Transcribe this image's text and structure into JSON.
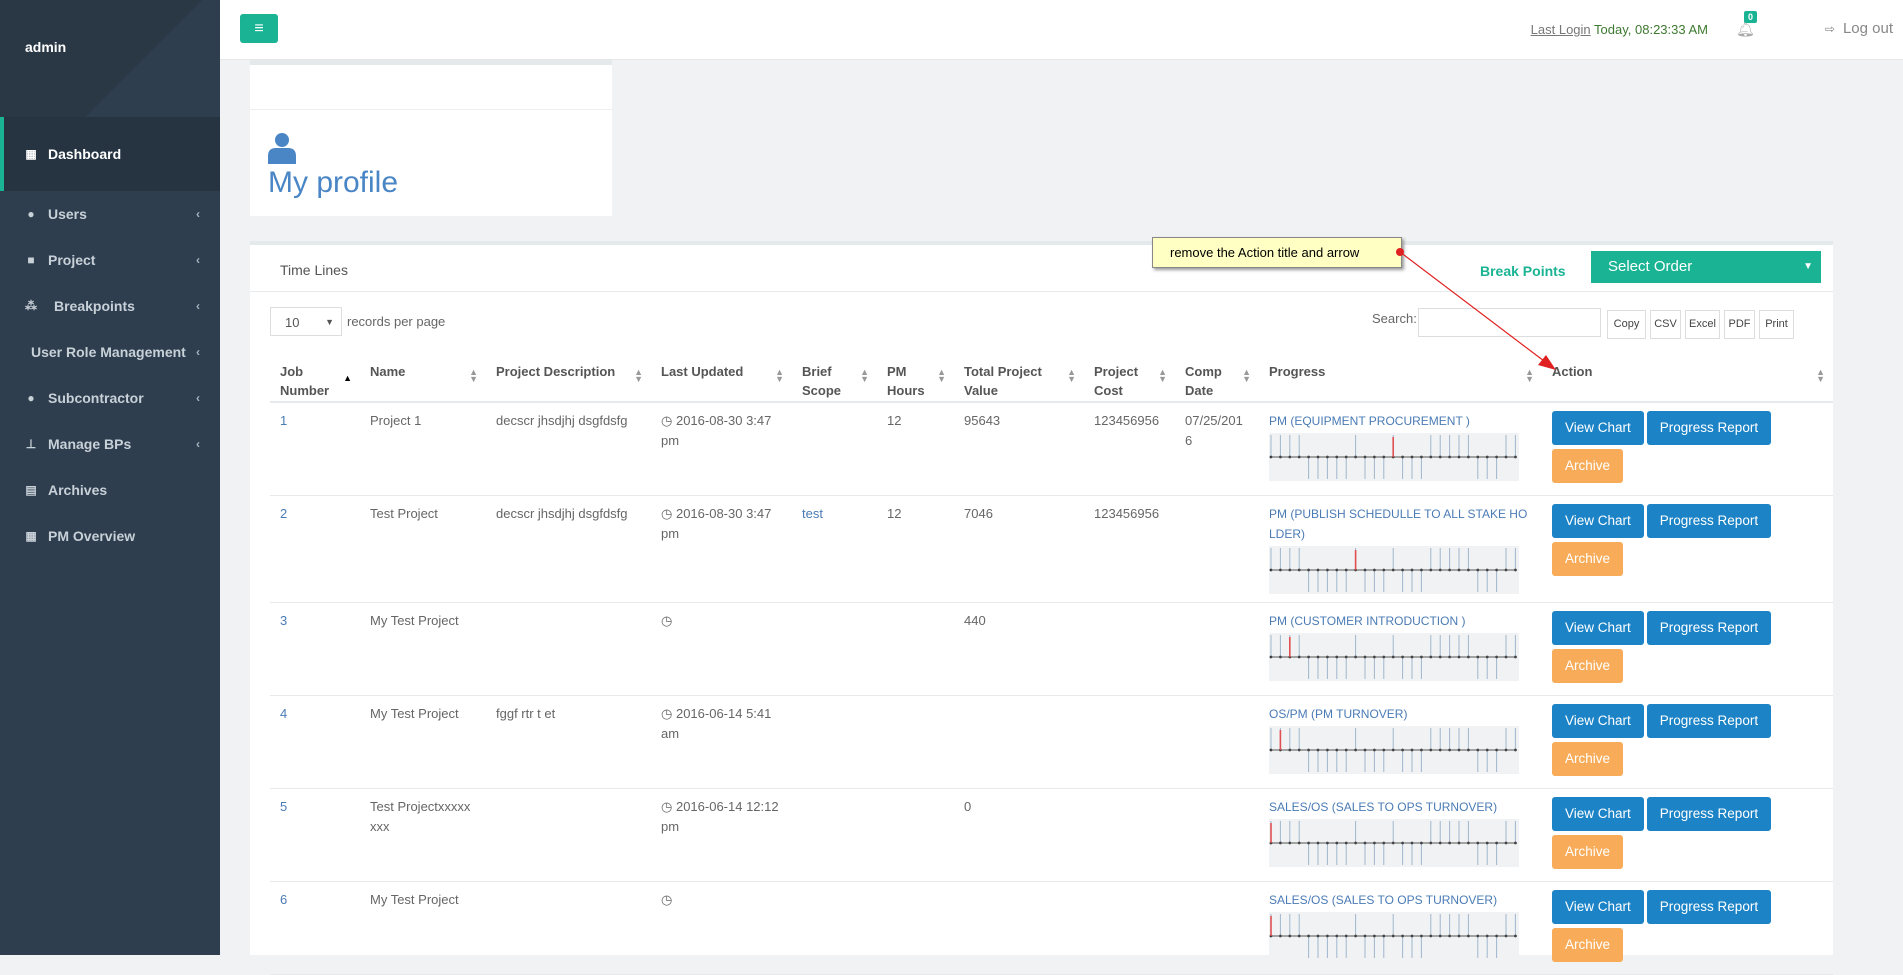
{
  "sidebar": {
    "user": "admin",
    "items": [
      {
        "label": "Dashboard",
        "icon": "th-large-icon"
      },
      {
        "label": "Users",
        "icon": "user-icon"
      },
      {
        "label": "Project",
        "icon": "folder-icon"
      },
      {
        "label": "Breakpoints",
        "icon": "cubes-icon"
      },
      {
        "label": "User Role Management",
        "icon": ""
      },
      {
        "label": "Subcontractor",
        "icon": "user-icon"
      },
      {
        "label": "Manage BPs",
        "icon": "sitemap-icon"
      },
      {
        "label": "Archives",
        "icon": "archive-icon"
      },
      {
        "label": "PM Overview",
        "icon": "table-icon"
      }
    ]
  },
  "topbar": {
    "last_login_label": "Last Login",
    "last_login_value": "Today, 08:23:33 AM",
    "notifications": "0",
    "logout": "Log out"
  },
  "profile": {
    "title": "My profile"
  },
  "panel": {
    "title": "Time Lines",
    "break_points": "Break Points",
    "select_order": "Select Order",
    "records_value": "10",
    "records_label": "records per page",
    "search_label": "Search:",
    "search_value": "",
    "export_buttons": [
      "Copy",
      "CSV",
      "Excel",
      "PDF",
      "Print"
    ]
  },
  "annotation": {
    "text": "remove the Action title and arrow",
    "color": "#e02020"
  },
  "table": {
    "headers": [
      "Job Number",
      "Name",
      "Project Description",
      "Last Updated",
      "Brief Scope",
      "PM Hours",
      "Total Project Value",
      "Project Cost",
      "Comp Date",
      "Progress",
      "Action"
    ],
    "buttons": {
      "view": "View Chart",
      "report": "Progress Report",
      "archive": "Archive"
    },
    "rows": [
      {
        "job": "1",
        "name": "Project 1",
        "desc": "decscr jhsdjhj dsgfdsfg",
        "updated": "2016-08-30 3:47 pm",
        "scope": "",
        "hours": "12",
        "value": "95643",
        "cost": "123456956",
        "comp": "07/25/2016",
        "progress": "PM (EQUIPMENT PROCUREMENT )",
        "marker_step": 13
      },
      {
        "job": "2",
        "name": "Test Project",
        "desc": "decscr jhsdjhj dsgfdsfg",
        "updated": "2016-08-30 3:47 pm",
        "scope": "test",
        "hours": "12",
        "value": "7046",
        "cost": "123456956",
        "comp": "",
        "progress": "PM (PUBLISH SCHEDULLE TO ALL STAKE HOLDER)",
        "marker_step": 9
      },
      {
        "job": "3",
        "name": "My Test Project",
        "desc": "",
        "updated": "",
        "scope": "",
        "hours": "",
        "value": "440",
        "cost": "",
        "comp": "",
        "progress": "PM (CUSTOMER INTRODUCTION )",
        "marker_step": 2
      },
      {
        "job": "4",
        "name": "My Test Project",
        "desc": "fggf rtr t et",
        "updated": "2016-06-14 5:41 am",
        "scope": "",
        "hours": "",
        "value": "",
        "cost": "",
        "comp": "",
        "progress": "OS/PM (PM TURNOVER)",
        "marker_step": 1
      },
      {
        "job": "5",
        "name": "Test Projectxxxxxxxx",
        "desc": "",
        "updated": "2016-06-14 12:12 pm",
        "scope": "",
        "hours": "",
        "value": "0",
        "cost": "",
        "comp": "",
        "progress": "SALES/OS (SALES TO OPS TURNOVER)",
        "marker_step": 0
      },
      {
        "job": "6",
        "name": "My Test Project",
        "desc": "",
        "updated": "",
        "scope": "",
        "hours": "",
        "value": "",
        "cost": "",
        "comp": "",
        "progress": "SALES/OS (SALES TO OPS TURNOVER)",
        "marker_step": 0
      }
    ]
  }
}
